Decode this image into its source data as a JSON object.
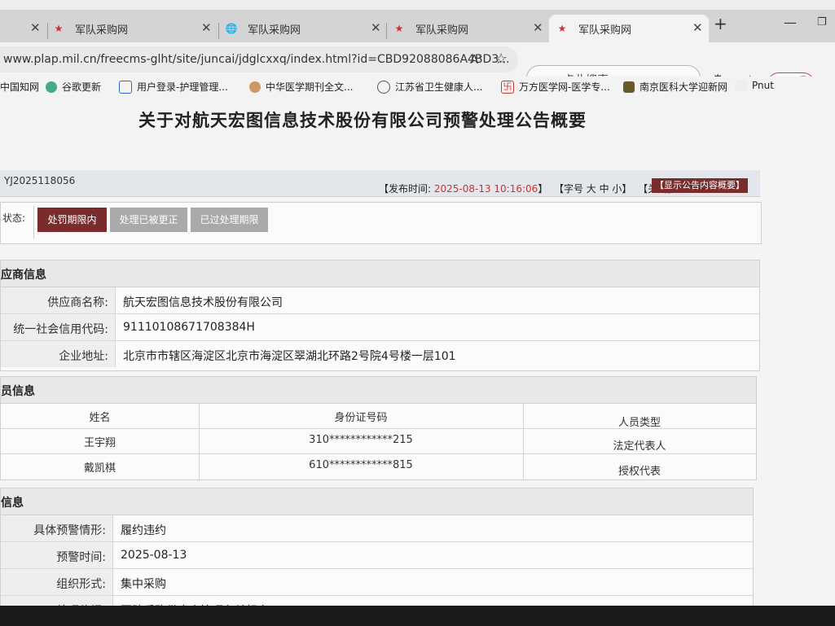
{
  "browser": {
    "tabs": [
      {
        "title": "",
        "close": "✕"
      },
      {
        "title": "军队采购网",
        "close": "✕"
      },
      {
        "title": "军队采购网",
        "close": "✕"
      },
      {
        "title": "军队采购网",
        "close": "✕"
      },
      {
        "title": "军队采购网",
        "close": "✕"
      }
    ],
    "new_tab": "+",
    "url": "www.plap.mil.cn/freecms-glht/site/juncai/jdglcxxq/index.html?id=CBD92088086A4BD3...",
    "search_placeholder": "点此搜索",
    "error_button": "错误",
    "bookmarks": [
      "中国知网",
      "谷歌更新",
      "用户登录-护理管理...",
      "中华医学期刊全文...",
      "江苏省卫生健康人...",
      "万方医学网-医学专...",
      "南京医科大学迎新网",
      "Pnut"
    ]
  },
  "page": {
    "title": "关于对航天宏图信息技术股份有限公司预警处理公告概要",
    "code": "YJ2025118056",
    "publish_label": "【发布时间: ",
    "publish_date": "2025-08-13 10:16:06",
    "publish_end": "】",
    "font_size_ctrl": "【字号 大 中 小】",
    "close_link": "【关闭】",
    "summary_button": "【显示公告内容概要】",
    "status_label": "状态:",
    "status_buttons": [
      "处罚期限内",
      "处理已被更正",
      "已过处理期限"
    ],
    "supplier_section": "应商信息",
    "supplier": [
      {
        "key": "供应商名称:",
        "value": "航天宏图信息技术股份有限公司"
      },
      {
        "key": "统一社会信用代码:",
        "value": "91110108671708384H"
      },
      {
        "key": "企业地址:",
        "value": "北京市市辖区海淀区北京市海淀区翠湖北环路2号院4号楼一层101"
      }
    ],
    "personnel_section": "员信息",
    "personnel_headers": [
      "姓名",
      "身份证号码",
      "人员类型"
    ],
    "personnel_rows": [
      [
        "王宇翔",
        "310************215",
        "法定代表人"
      ],
      [
        "戴凯棋",
        "610************815",
        "授权代表"
      ]
    ],
    "info_section": "信息",
    "info": [
      {
        "key": "具体预警情形:",
        "value": "履约违约"
      },
      {
        "key": "预警时间:",
        "value": "2025-08-13"
      },
      {
        "key": "组织形式:",
        "value": "集中采购"
      },
      {
        "key": "处理依据:",
        "value": "军队采购供应商管理有关规定"
      }
    ]
  }
}
